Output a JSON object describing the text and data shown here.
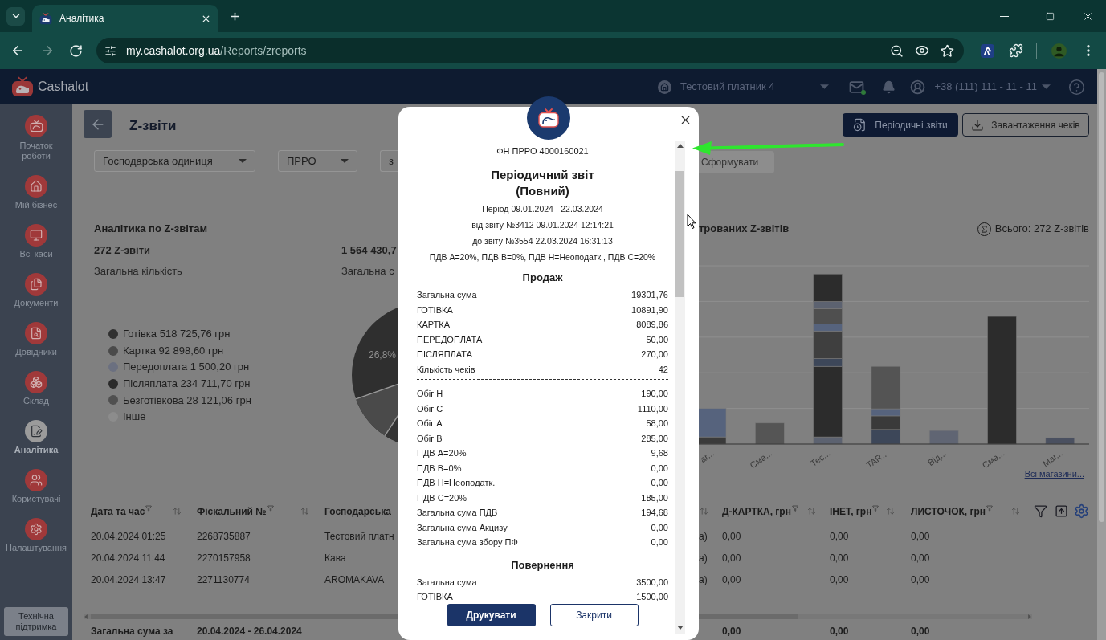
{
  "browser": {
    "tab_title": "Аналітика",
    "url_host": "my.cashalot.org.ua",
    "url_path": "/Reports/zreports"
  },
  "app_header": {
    "logo": "Cashalot",
    "company": "Тестовий платник 4",
    "phone": "+38 (111) 111 - 11 - 11"
  },
  "sidebar": {
    "items": [
      {
        "label": "Початок роботи",
        "selected": false
      },
      {
        "label": "Мій бізнес",
        "selected": false
      },
      {
        "label": "Всі каси",
        "selected": false
      },
      {
        "label": "Документи",
        "selected": false
      },
      {
        "label": "Довідники",
        "selected": false
      },
      {
        "label": "Склад",
        "selected": false
      },
      {
        "label": "Аналітика",
        "selected": true
      },
      {
        "label": "Користувачі",
        "selected": false
      },
      {
        "label": "Налаштування",
        "selected": false
      }
    ],
    "support_button": "Технічна підтримка"
  },
  "page": {
    "title": "Z-звіти",
    "actions": [
      {
        "label": "Періодичні звіти",
        "kind": "primary"
      },
      {
        "label": "Завантаження чеків",
        "kind": "outline"
      }
    ]
  },
  "filters": {
    "selects": [
      "Господарська одиниця",
      "ПРРО",
      "з"
    ],
    "submit": {
      "label": "Сформувати",
      "disabled": true
    }
  },
  "analytics": {
    "title": "Аналітика по Z-звітам",
    "stats": [
      {
        "value": "272 Z-звіти",
        "label": "Загальна кількість"
      },
      {
        "value": "1 564 430,7",
        "label": "Загальна с"
      }
    ],
    "legend": [
      {
        "label": "Готівка 518 725,76 грн",
        "color": "#303030"
      },
      {
        "label": "Картка 92 898,60 грн",
        "color": "#4a4a4a"
      },
      {
        "label": "Передоплата 1 500,20 грн",
        "color": "#6b7080"
      },
      {
        "label": "Післяплата 234 711,70 грн",
        "color": "#2a2a2a"
      },
      {
        "label": "Безготівкова 28 121,06 грн",
        "color": "#505050"
      },
      {
        "label": "Інше",
        "color": "#8c8c8c"
      }
    ],
    "pie": {
      "label": "26,8%"
    }
  },
  "bar_chart": {
    "title": "трованих Z-звітів",
    "total": "Всього: 272 Z-звітів",
    "category_labels": [
      "ar...",
      "Сма...",
      "Тес...",
      "TAR...",
      "Від...",
      "Сма...",
      "Маг..."
    ],
    "link": "Всі магазини..."
  },
  "table": {
    "columns": [
      {
        "label": "Дата та час",
        "filter": true,
        "sort": true
      },
      {
        "label": "Фіскальний №",
        "filter": true,
        "sort": true
      },
      {
        "label": "Господарська",
        "filter": false,
        "sort": false
      },
      {
        "filter": false,
        "sort": true
      },
      {
        "label": "Д-КАРТКА, грн",
        "filter": true,
        "sort": true
      },
      {
        "label": "ІНЕТ, грн",
        "filter": true,
        "sort": true
      },
      {
        "label": "ЛИСТОЧОК, грн",
        "filter": true,
        "sort": true
      }
    ],
    "rows": [
      [
        "20.04.2024 01:25",
        "2268735887",
        "Тестовий платн",
        "а)",
        "0,00",
        "0,00",
        "0,00"
      ],
      [
        "20.04.2024 11:44",
        "2270157958",
        "Кава",
        "а)",
        "0,00",
        "0,00",
        "0,00"
      ],
      [
        "20.04.2024 13:47",
        "2271130774",
        "AROMAKAVA",
        "а)",
        "0,00",
        "0,00",
        "0,00"
      ]
    ],
    "totals": {
      "label": "Загальна сума за",
      "period": "20.04.2024 - 26.04.2024",
      "values": [
        "0,00",
        "0,00",
        "0,00"
      ]
    }
  },
  "modal": {
    "fiscal_number": "ФН ПРРО 4000160021",
    "title": "Періодичний звіт",
    "subtitle": "(Повний)",
    "info": [
      "Період 09.01.2024 - 22.03.2024",
      "від звіту №3412 09.01.2024 12:14:21",
      "до звіту №3554 22.03.2024 16:31:13",
      "ПДВ А=20%, ПДВ В=0%, ПДВ Н=Неоподатк., ПДВ С=20%"
    ],
    "blocks": [
      {
        "kind": "heading",
        "text": "Продаж"
      },
      {
        "kind": "rows",
        "rows": [
          [
            "Загальна сума",
            "19301,76"
          ],
          [
            "ГОТІВКА",
            "10891,90"
          ],
          [
            "КАРТКА",
            "8089,86"
          ],
          [
            "ПЕРЕДОПЛАТА",
            "50,00"
          ],
          [
            "ПІСЛЯПЛАТА",
            "270,00"
          ],
          [
            "Кількість чеків",
            "42"
          ]
        ]
      },
      {
        "kind": "divider"
      },
      {
        "kind": "rows",
        "rows": [
          [
            "Обіг Н",
            "190,00"
          ],
          [
            "Обіг С",
            "1110,00"
          ],
          [
            "Обіг А",
            "58,00"
          ],
          [
            "Обіг В",
            "285,00"
          ],
          [
            "ПДВ А=20%",
            "9,68"
          ],
          [
            "ПДВ В=0%",
            "0,00"
          ],
          [
            "ПДВ Н=Неоподатк.",
            "0,00"
          ],
          [
            "ПДВ С=20%",
            "185,00"
          ],
          [
            "Загальна сума ПДВ",
            "194,68"
          ],
          [
            "Загальна сума Акцизу",
            "0,00"
          ],
          [
            "Загальна сума збору ПФ",
            "0,00"
          ]
        ]
      },
      {
        "kind": "heading",
        "text": "Повернення"
      },
      {
        "kind": "rows",
        "rows": [
          [
            "Загальна сума",
            "3500,00"
          ],
          [
            "ГОТІВКА",
            "1500,00"
          ]
        ]
      }
    ],
    "buttons": [
      {
        "label": "Друкувати",
        "kind": "primary"
      },
      {
        "label": "Закрити",
        "kind": "outline"
      }
    ]
  }
}
